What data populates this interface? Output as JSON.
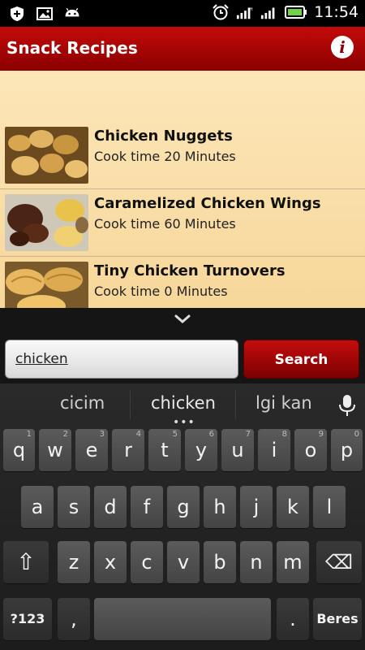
{
  "status_bar": {
    "time": "11:54",
    "left_icons": [
      "plus-shield-icon",
      "image-icon",
      "android-icon"
    ],
    "right_icons": [
      "alarm-icon",
      "signal-icon",
      "signal-icon",
      "battery-icon"
    ]
  },
  "header": {
    "title": "Snack Recipes",
    "info_label": "i",
    "colors": {
      "start": "#c40a0a",
      "end": "#8a0000"
    }
  },
  "recipes": [
    {
      "name": "Chicken Nuggets",
      "time": "Cook time 20 Minutes"
    },
    {
      "name": "Caramelized Chicken Wings",
      "time": "Cook time 60 Minutes"
    },
    {
      "name": "Tiny Chicken Turnovers",
      "time": "Cook time 0 Minutes"
    }
  ],
  "search": {
    "value": "chicken",
    "button_label": "Search"
  },
  "keyboard": {
    "suggestions": [
      "cicim",
      "chicken",
      "lgi kan"
    ],
    "suggestion_dots": "•••",
    "row1": [
      {
        "ch": "q",
        "sup": "1"
      },
      {
        "ch": "w",
        "sup": "2"
      },
      {
        "ch": "e",
        "sup": "3"
      },
      {
        "ch": "r",
        "sup": "4"
      },
      {
        "ch": "t",
        "sup": "5"
      },
      {
        "ch": "y",
        "sup": "6"
      },
      {
        "ch": "u",
        "sup": "7"
      },
      {
        "ch": "i",
        "sup": "8"
      },
      {
        "ch": "o",
        "sup": "9"
      },
      {
        "ch": "p",
        "sup": "0"
      }
    ],
    "row2": [
      "a",
      "s",
      "d",
      "f",
      "g",
      "h",
      "j",
      "k",
      "l"
    ],
    "row3": [
      "z",
      "x",
      "c",
      "v",
      "b",
      "n",
      "m"
    ],
    "shift_label": "⇧",
    "backspace_label": "⌫",
    "symbols_label": "?123",
    "comma_label": ",",
    "period_label": ".",
    "enter_label": "Beres"
  }
}
